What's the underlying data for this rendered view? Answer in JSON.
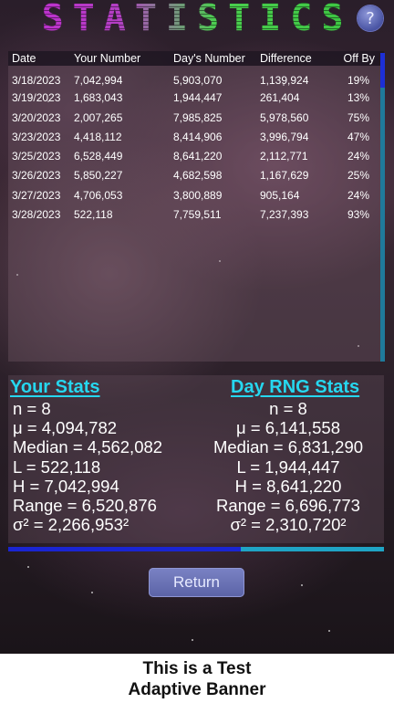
{
  "header": {
    "title": "STATISTICS",
    "help_label": "?"
  },
  "table": {
    "columns": [
      "Date",
      "Your Number",
      "Day's Number",
      "Difference",
      "Off By"
    ],
    "rows": [
      [
        "3/18/2023",
        "7,042,994",
        "5,903,070",
        "1,139,924",
        "19%"
      ],
      [
        "3/19/2023",
        "1,683,043",
        "1,944,447",
        "261,404",
        "13%"
      ],
      [
        "3/20/2023",
        "2,007,265",
        "7,985,825",
        "5,978,560",
        "75%"
      ],
      [
        "3/23/2023",
        "4,418,112",
        "8,414,906",
        "3,996,794",
        "47%"
      ],
      [
        "3/25/2023",
        "6,528,449",
        "8,641,220",
        "2,112,771",
        "24%"
      ],
      [
        "3/26/2023",
        "5,850,227",
        "4,682,598",
        "1,167,629",
        "25%"
      ],
      [
        "3/27/2023",
        "4,706,053",
        "3,800,889",
        "905,164",
        "24%"
      ],
      [
        "3/28/2023",
        "522,118",
        "7,759,511",
        "7,237,393",
        "93%"
      ]
    ]
  },
  "your_stats": {
    "heading": "Your Stats",
    "lines": [
      "n = 8",
      "μ = 4,094,782",
      "Median = 4,562,082",
      "L = 522,118",
      "H = 7,042,994",
      "Range = 6,520,876",
      "σ² = 2,266,953²"
    ]
  },
  "day_stats": {
    "heading": "Day RNG Stats",
    "lines": [
      "n = 8",
      "μ = 6,141,558",
      "Median = 6,831,290",
      "L = 1,944,447",
      "H = 8,641,220",
      "Range = 6,696,773",
      "σ² = 2,310,720²"
    ]
  },
  "progress": {
    "fraction": 0.62,
    "fill_color": "#1a25d2",
    "track_color": "#1fa4c5"
  },
  "return_label": "Return",
  "banner": {
    "line1": "This is a Test",
    "line2": "Adaptive Banner"
  },
  "colors": {
    "accent": "#26d7ef",
    "title_left": "#c22bd1",
    "title_right": "#39c23f"
  }
}
